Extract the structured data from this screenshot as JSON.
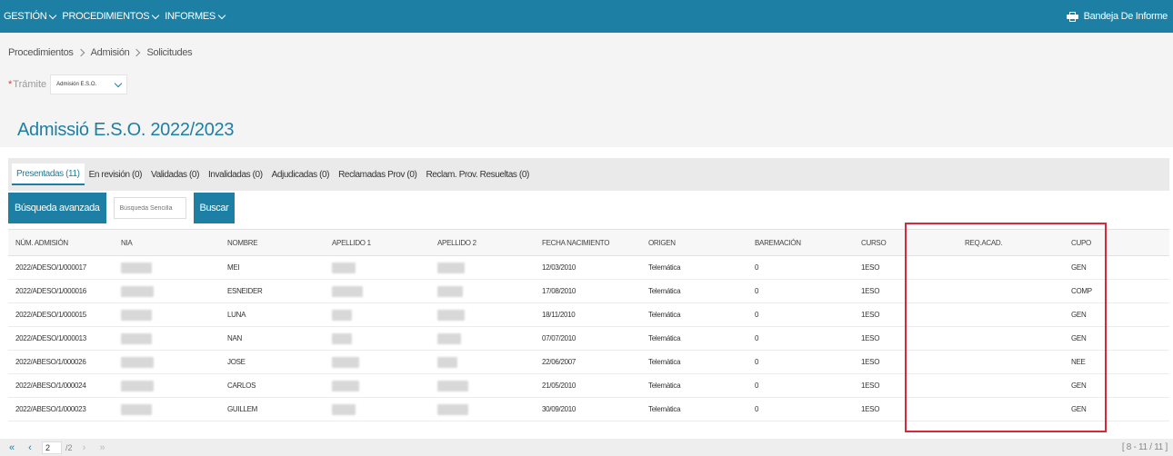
{
  "topbar": {
    "menu": [
      {
        "label": "GESTIÓN"
      },
      {
        "label": "PROCEDIMIENTOS"
      },
      {
        "label": "INFORMES"
      }
    ],
    "inbox_label": "Bandeja De Informe",
    "inbox_icon": "printer-icon"
  },
  "breadcrumb": {
    "items": [
      "Procedimientos",
      "Admisión",
      "Solicitudes"
    ]
  },
  "tramite": {
    "label": "Trámite",
    "required_mark": "*",
    "selected": "Admisión E.S.O."
  },
  "page": {
    "title": "Admissió E.S.O. 2022/2023"
  },
  "tabs": [
    {
      "label": "Presentadas (11)",
      "active": true
    },
    {
      "label": "En revisión (0)"
    },
    {
      "label": "Validadas (0)"
    },
    {
      "label": "Invalidadas (0)"
    },
    {
      "label": "Adjudicadas (0)"
    },
    {
      "label": "Reclamadas Prov (0)"
    },
    {
      "label": "Reclam. Prov. Resueltas (0)"
    }
  ],
  "search": {
    "advanced_label": "Búsqueda avanzada",
    "placeholder": "Búsqueda Sencilla",
    "button_label": "Buscar"
  },
  "table": {
    "headers": [
      "NÚM. ADMISIÓN",
      "NIA",
      "NOMBRE",
      "APELLIDO 1",
      "APELLIDO 2",
      "FECHA NACIMIENTO",
      "ORIGEN",
      "BAREMACIÓN",
      "CURSO",
      "REQ.ACAD.",
      "CUPO"
    ],
    "rows": [
      {
        "num": "2022/ADESO/1/000017",
        "nombre": "MEI",
        "fecha": "12/03/2010",
        "origen": "Telemática",
        "baremacion": "0",
        "curso": "1ESO",
        "req": "",
        "cupo": "GEN"
      },
      {
        "num": "2022/ADESO/1/000016",
        "nombre": "ESNEIDER",
        "fecha": "17/08/2010",
        "origen": "Telemática",
        "baremacion": "0",
        "curso": "1ESO",
        "req": "",
        "cupo": "COMP"
      },
      {
        "num": "2022/ADESO/1/000015",
        "nombre": "LUNA",
        "fecha": "18/11/2010",
        "origen": "Telemática",
        "baremacion": "0",
        "curso": "1ESO",
        "req": "",
        "cupo": "GEN"
      },
      {
        "num": "2022/ADESO/1/000013",
        "nombre": "NAN",
        "fecha": "07/07/2010",
        "origen": "Telemática",
        "baremacion": "0",
        "curso": "1ESO",
        "req": "",
        "cupo": "GEN"
      },
      {
        "num": "2022/ABESO/1/000026",
        "nombre": "JOSE",
        "fecha": "22/06/2007",
        "origen": "Telemàtica",
        "baremacion": "0",
        "curso": "1ESO",
        "req": "",
        "cupo": "NEE"
      },
      {
        "num": "2022/ABESO/1/000024",
        "nombre": "CARLOS",
        "fecha": "21/05/2010",
        "origen": "Telemàtica",
        "baremacion": "0",
        "curso": "1ESO",
        "req": "",
        "cupo": "GEN"
      },
      {
        "num": "2022/ABESO/1/000023",
        "nombre": "GUILLEM",
        "fecha": "30/09/2010",
        "origen": "Telemàtica",
        "baremacion": "0",
        "curso": "1ESO",
        "req": "",
        "cupo": "GEN"
      }
    ]
  },
  "pager": {
    "page": "2",
    "total": "/2",
    "range": "[ 8 - 11 / 11 ]"
  },
  "colors": {
    "brand": "#1d7fa3",
    "highlight": "#d9283a"
  }
}
